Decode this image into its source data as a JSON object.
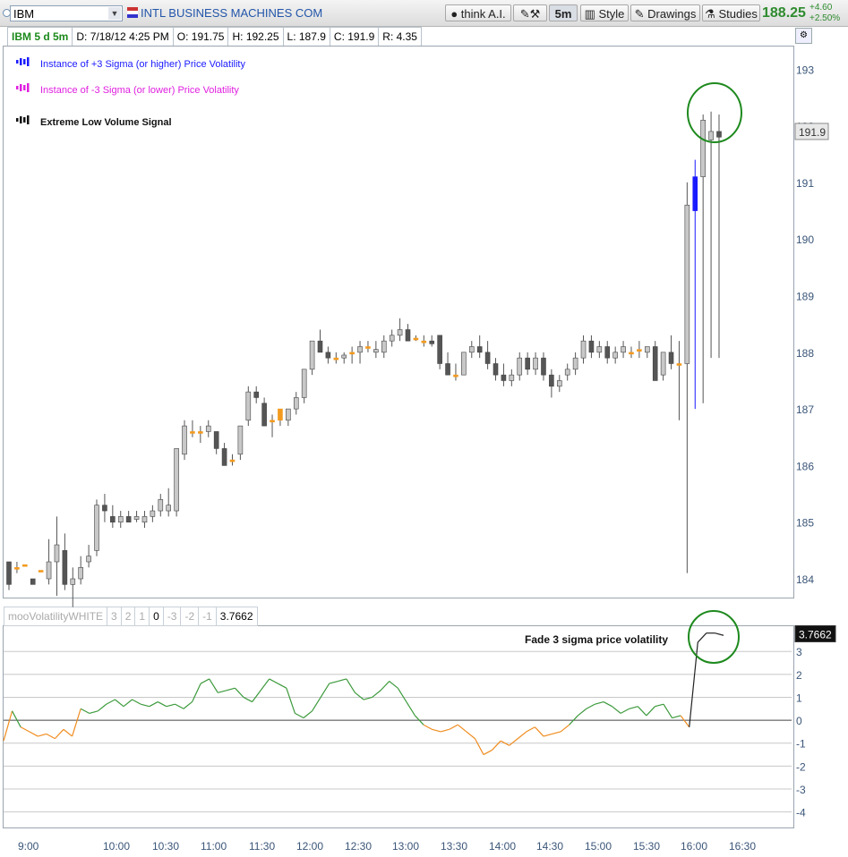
{
  "toolbar": {
    "symbol": "IBM",
    "company": "INTL BUSINESS MACHINES COM",
    "think": "think A.I.",
    "timeframe": "5m",
    "style": "Style",
    "drawings": "Drawings",
    "studies": "Studies",
    "last_price": "188.25",
    "change": "+4.60",
    "change_pct": "+2.50%"
  },
  "header": {
    "symbol_period": "IBM 5 d 5m",
    "date": "D: 7/18/12 4:25 PM",
    "open": "O: 191.75",
    "high": "H: 192.25",
    "low": "L: 187.9",
    "close": "C: 191.9",
    "range": "R: 4.35"
  },
  "legend": [
    {
      "label": "Instance of +3 Sigma (or higher) Price Volatility",
      "color": "#1a1aff"
    },
    {
      "label": "Instance of -3 Sigma  (or lower) Price Volatility",
      "color": "#e020e0"
    },
    {
      "label": "Extreme Low Volume Signal",
      "color": "#111111"
    }
  ],
  "colors": {
    "up": "#c8c8c8",
    "down": "#555555",
    "flat": "#f39a1e",
    "sigma_up": "#1a1aff",
    "osc_pos": "#3c9a3c",
    "osc_neg": "#f08c1e",
    "circle": "#1e8a1e"
  },
  "indicator": {
    "name": "mooVolatilityWHITE",
    "params": [
      "3",
      "2",
      "1",
      "0",
      "-3",
      "-2",
      "-1"
    ],
    "value": "3.7662",
    "annotation": "Fade 3 sigma price volatility"
  },
  "price_marker": "191.9",
  "chart_data": [
    {
      "type": "candlestick",
      "yaxis_ticks": [
        "193",
        "192",
        "191",
        "190",
        "189",
        "188",
        "187",
        "186",
        "185",
        "184"
      ],
      "ylim": [
        183.7,
        193.4
      ],
      "x_ticks": [
        "9:00",
        "10:00",
        "10:30",
        "11:00",
        "11:30",
        "12:00",
        "12:30",
        "13:00",
        "13:30",
        "14:00",
        "14:30",
        "15:00",
        "15:30",
        "16:00",
        "16:30"
      ],
      "candles": [
        [
          184.3,
          184.3,
          183.8,
          183.9
        ],
        [
          184.2,
          184.3,
          184.1,
          184.2
        ],
        [
          184.25,
          184.25,
          184.25,
          184.25
        ],
        [
          184.0,
          184.0,
          183.9,
          183.9
        ],
        [
          184.15,
          184.15,
          184.15,
          184.15
        ],
        [
          184.0,
          184.7,
          183.9,
          184.3
        ],
        [
          184.3,
          185.1,
          183.7,
          184.6
        ],
        [
          184.5,
          184.8,
          183.8,
          183.9
        ],
        [
          183.9,
          184.2,
          183.5,
          184.0
        ],
        [
          184.0,
          184.4,
          183.9,
          184.2
        ],
        [
          184.3,
          184.6,
          184.2,
          184.4
        ],
        [
          184.5,
          185.4,
          184.4,
          185.3
        ],
        [
          185.3,
          185.5,
          185.0,
          185.2
        ],
        [
          185.1,
          185.3,
          184.9,
          185.0
        ],
        [
          185.0,
          185.2,
          184.9,
          185.1
        ],
        [
          185.1,
          185.2,
          185.0,
          185.0
        ],
        [
          185.05,
          185.2,
          185.0,
          185.1
        ],
        [
          185.0,
          185.2,
          184.9,
          185.1
        ],
        [
          185.1,
          185.3,
          185.0,
          185.2
        ],
        [
          185.2,
          185.5,
          185.1,
          185.4
        ],
        [
          185.2,
          185.6,
          185.1,
          185.3
        ],
        [
          185.2,
          186.3,
          185.1,
          186.3
        ],
        [
          186.2,
          186.8,
          186.1,
          186.7
        ],
        [
          186.6,
          186.8,
          186.5,
          186.6
        ],
        [
          186.6,
          186.7,
          186.4,
          186.6
        ],
        [
          186.6,
          186.8,
          186.5,
          186.7
        ],
        [
          186.6,
          186.6,
          186.2,
          186.3
        ],
        [
          186.3,
          186.4,
          186.0,
          186.0
        ],
        [
          186.1,
          186.2,
          186.0,
          186.1
        ],
        [
          186.2,
          186.7,
          186.1,
          186.7
        ],
        [
          186.8,
          187.4,
          186.7,
          187.3
        ],
        [
          187.3,
          187.4,
          187.1,
          187.2
        ],
        [
          187.1,
          187.2,
          186.7,
          186.7
        ],
        [
          186.8,
          186.9,
          186.5,
          186.8
        ],
        [
          186.8,
          187.0,
          186.7,
          187.0
        ],
        [
          186.8,
          187.0,
          186.7,
          187.0
        ],
        [
          187.0,
          187.3,
          186.9,
          187.2
        ],
        [
          187.2,
          187.7,
          187.1,
          187.7
        ],
        [
          187.7,
          188.2,
          187.6,
          188.2
        ],
        [
          188.2,
          188.4,
          188.0,
          188.0
        ],
        [
          188.0,
          188.1,
          187.8,
          187.9
        ],
        [
          187.9,
          188.0,
          187.8,
          187.9
        ],
        [
          187.9,
          188.0,
          187.8,
          187.95
        ],
        [
          188.0,
          188.1,
          187.8,
          188.0
        ],
        [
          188.0,
          188.2,
          187.8,
          188.1
        ],
        [
          188.1,
          188.2,
          188.0,
          188.1
        ],
        [
          188.0,
          188.2,
          187.9,
          188.05
        ],
        [
          188.0,
          188.3,
          187.9,
          188.2
        ],
        [
          188.2,
          188.4,
          188.1,
          188.3
        ],
        [
          188.3,
          188.6,
          188.2,
          188.4
        ],
        [
          188.4,
          188.5,
          188.2,
          188.2
        ],
        [
          188.25,
          188.3,
          188.2,
          188.25
        ],
        [
          188.2,
          188.3,
          188.1,
          188.2
        ],
        [
          188.2,
          188.3,
          188.1,
          188.15
        ],
        [
          188.3,
          188.3,
          187.7,
          187.8
        ],
        [
          187.8,
          188.0,
          187.6,
          187.6
        ],
        [
          187.6,
          187.8,
          187.5,
          187.6
        ],
        [
          187.6,
          188.0,
          187.6,
          188.0
        ],
        [
          188.0,
          188.2,
          187.9,
          188.1
        ],
        [
          188.1,
          188.3,
          187.9,
          188.0
        ],
        [
          188.0,
          188.2,
          187.7,
          187.8
        ],
        [
          187.8,
          187.9,
          187.5,
          187.6
        ],
        [
          187.6,
          187.8,
          187.4,
          187.5
        ],
        [
          187.5,
          187.7,
          187.4,
          187.6
        ],
        [
          187.6,
          188.0,
          187.5,
          187.9
        ],
        [
          187.9,
          188.0,
          187.6,
          187.7
        ],
        [
          187.7,
          188.0,
          187.6,
          187.9
        ],
        [
          187.9,
          188.0,
          187.5,
          187.6
        ],
        [
          187.6,
          187.7,
          187.2,
          187.4
        ],
        [
          187.4,
          187.6,
          187.3,
          187.5
        ],
        [
          187.6,
          187.8,
          187.5,
          187.7
        ],
        [
          187.7,
          188.0,
          187.6,
          187.9
        ],
        [
          187.9,
          188.3,
          187.8,
          188.2
        ],
        [
          188.2,
          188.3,
          187.9,
          188.0
        ],
        [
          188.0,
          188.2,
          187.9,
          188.1
        ],
        [
          188.1,
          188.2,
          187.8,
          187.9
        ],
        [
          187.9,
          188.1,
          187.8,
          188.0
        ],
        [
          188.0,
          188.2,
          187.9,
          188.1
        ],
        [
          188.0,
          188.1,
          187.9,
          188.0
        ],
        [
          188.05,
          188.2,
          187.9,
          188.05
        ],
        [
          188.0,
          188.1,
          187.9,
          188.1
        ],
        [
          188.1,
          188.2,
          187.5,
          187.5
        ],
        [
          187.6,
          188.0,
          187.5,
          188.0
        ],
        [
          188.0,
          188.3,
          187.7,
          187.8
        ],
        [
          187.8,
          188.2,
          186.8,
          187.8
        ],
        [
          187.8,
          191.0,
          184.1,
          190.6
        ],
        [
          190.5,
          191.4,
          187.0,
          191.1
        ],
        [
          191.1,
          192.2,
          187.1,
          192.1
        ],
        [
          191.75,
          192.25,
          187.9,
          191.9
        ],
        [
          191.9,
          192.2,
          187.9,
          191.8
        ]
      ],
      "sigma_up_indices": [
        86
      ],
      "flat_indices": [
        2,
        4,
        34,
        79
      ]
    },
    {
      "type": "line",
      "name": "mooVolatilityWHITE",
      "ylim": [
        -4.6,
        4.1
      ],
      "yaxis_ticks": [
        "3",
        "2",
        "1",
        "0",
        "-1",
        "-2",
        "-3",
        "-4"
      ],
      "values": [
        -0.9,
        0.4,
        -0.3,
        -0.5,
        -0.7,
        -0.6,
        -0.8,
        -0.4,
        -0.7,
        0.5,
        0.3,
        0.4,
        0.7,
        0.9,
        0.6,
        0.9,
        0.7,
        0.6,
        0.8,
        0.6,
        0.7,
        0.5,
        0.8,
        1.6,
        1.8,
        1.2,
        1.3,
        1.4,
        1.0,
        0.8,
        1.3,
        1.8,
        1.6,
        1.4,
        0.3,
        0.1,
        0.4,
        1.0,
        1.6,
        1.7,
        1.8,
        1.2,
        0.9,
        1.0,
        1.3,
        1.7,
        1.4,
        0.8,
        0.2,
        -0.2,
        -0.4,
        -0.5,
        -0.4,
        -0.2,
        -0.5,
        -0.8,
        -1.5,
        -1.3,
        -0.9,
        -1.1,
        -0.8,
        -0.5,
        -0.3,
        -0.7,
        -0.6,
        -0.5,
        -0.2,
        0.2,
        0.5,
        0.7,
        0.8,
        0.6,
        0.3,
        0.5,
        0.6,
        0.2,
        0.6,
        0.7,
        0.1,
        0.2,
        -0.3,
        3.4,
        3.8,
        3.8,
        3.7
      ]
    }
  ]
}
